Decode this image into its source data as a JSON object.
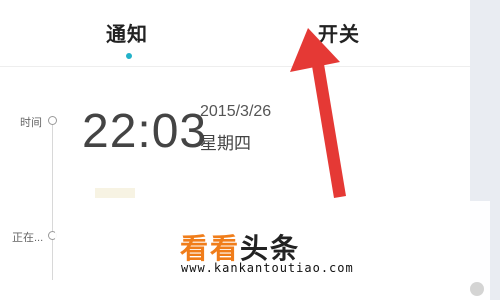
{
  "tabs": [
    {
      "label": "通知",
      "active": true
    },
    {
      "label": "开关",
      "active": false
    }
  ],
  "timeline": {
    "labels": [
      "时间",
      "正在..."
    ]
  },
  "clock": {
    "time": "22:03",
    "date": "2015/3/26",
    "weekday": "星期四"
  },
  "watermark": {
    "title_accent": "看看",
    "title_rest": "头条",
    "url": "www.kankantoutiao.com"
  },
  "colors": {
    "accent": "#22b2c9",
    "arrow": "#e53935",
    "watermark_accent": "#f07d1a"
  }
}
